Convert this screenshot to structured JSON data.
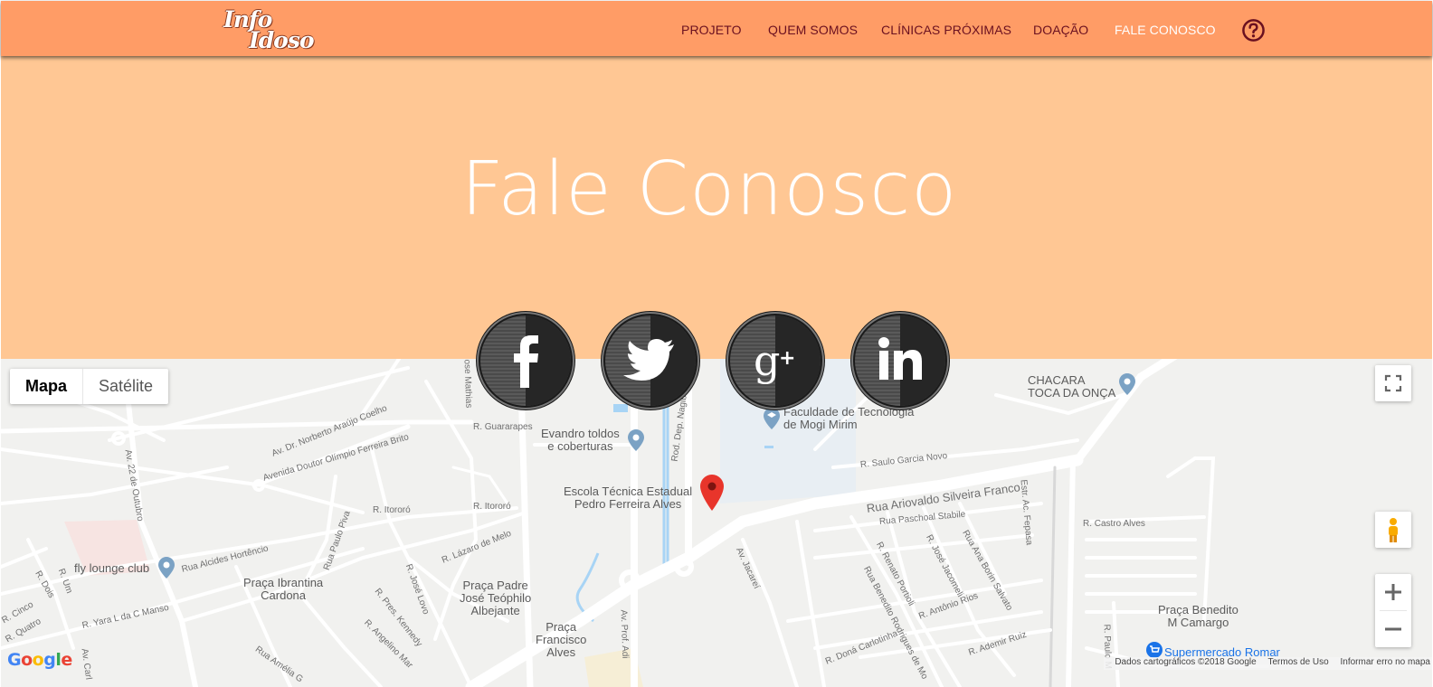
{
  "logo": {
    "line1": "Info",
    "line2": "Idoso"
  },
  "nav": {
    "items": [
      {
        "label": "PROJETO"
      },
      {
        "label": "QUEM SOMOS"
      },
      {
        "label": "CLÍNICAS PRÓXIMAS"
      },
      {
        "label": "DOAÇÃO"
      },
      {
        "label": "FALE CONOSCO"
      }
    ],
    "help_icon": "question-circle-icon"
  },
  "hero": {
    "title": "Fale Conosco"
  },
  "social": [
    {
      "name": "facebook",
      "icon": "facebook-icon"
    },
    {
      "name": "twitter",
      "icon": "twitter-icon"
    },
    {
      "name": "google-plus",
      "icon": "google-plus-icon"
    },
    {
      "name": "linkedin",
      "icon": "linkedin-icon"
    }
  ],
  "map": {
    "type_controls": {
      "map": "Mapa",
      "satellite": "Satélite"
    },
    "places": {
      "chacara": "CHACARA\nTOCA DA ONÇA",
      "faculdade": "Faculdade de Tecnologia\nde Mogi Mirim",
      "evandro": "Evandro toldos\ne coberturas",
      "escola": "Escola Técnica Estadual\nPedro Ferreira Alves",
      "fly": "fly lounge club",
      "ibrantina": "Praça Ibrantina\nCardona",
      "padre": "Praça Padre\nJosé Teóphilo\nAlbejante",
      "francisco": "Praça\nFrancisco\nAlves",
      "benedito": "Praça Benedito\nM Camargo",
      "supermercado": "Supermercado Romar"
    },
    "streets": {
      "s1": "Av. Dr. Norberto Araújo Coelho",
      "s2": "Avenida Doutor Olímpio Ferreira Brito",
      "s3": "R. Guararapes",
      "s4": "Av. 22 de Outubro",
      "s5": "R. Itororó",
      "s6": "R. Itororó",
      "s7": "Rua Alcides Hortêncio",
      "s8": "R. Yara L da C Manso",
      "s9": "R. Cinco",
      "s10": "R. Quatro",
      "s11": "R. Dois",
      "s12": "R. Um",
      "s13": "Rua Paulo Piva",
      "s14": "R. Lázaro de Melo",
      "s15": "R. José Lovo",
      "s16": "R. Pres. Kennedy",
      "s17": "R. Angelino Mar",
      "s18": "Rua Amélia G",
      "s19": "Av. Prof. Adi",
      "s20": "Rod. Dep. Nagib",
      "s21": "Rua Ariovaldo Silveira Franco",
      "s22": "R. Saulo Garcia Novo",
      "s23": "Rua Paschoal Stabile",
      "s24": "Av. Jacareí",
      "s25": "R. Renato Portioli",
      "s26": "R. José Jacomeli",
      "s27": "Rua Ana Borin Salvato",
      "s28": "R. Antônio Rios",
      "s29": "Rua Benedito Rodrigues de Mo",
      "s30": "R. Doná Carlotinha",
      "s31": "R. Ademir Ruiz",
      "s32": "R. Castro Alves",
      "s33": "Estr. Ac. Fepasa",
      "s34": "R. Paulo M",
      "s35": "ose Mathias",
      "s36": "Av. Carl"
    },
    "attribution": {
      "data": "Dados cartográficos ©2018 Google",
      "terms": "Termos de Uso",
      "report": "Informar erro no mapa"
    },
    "logo": "Google"
  }
}
